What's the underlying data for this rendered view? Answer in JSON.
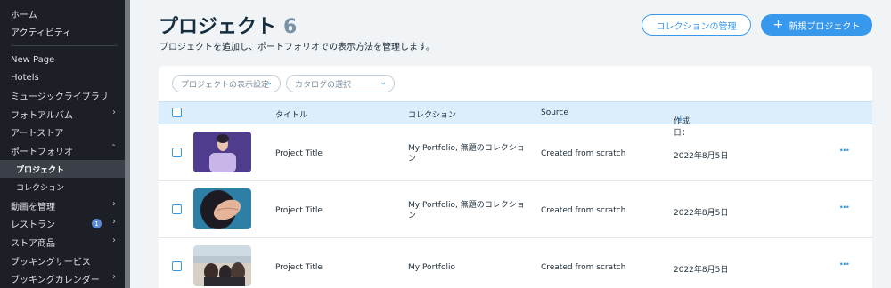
{
  "sidebar": {
    "items": [
      {
        "label": "ホーム"
      },
      {
        "label": "アクティビティ"
      },
      {
        "label": "New Page"
      },
      {
        "label": "Hotels"
      },
      {
        "label": "ミュージックライブラリ"
      },
      {
        "label": "フォトアルバム"
      },
      {
        "label": "アートストア"
      },
      {
        "label": "ポートフォリオ"
      },
      {
        "label": "プロジェクト"
      },
      {
        "label": "コレクション"
      },
      {
        "label": "動画を管理"
      },
      {
        "label": "レストラン",
        "badge": "1"
      },
      {
        "label": "ストア商品"
      },
      {
        "label": "ブッキングサービス"
      },
      {
        "label": "ブッキングカレンダー"
      }
    ]
  },
  "header": {
    "title": "プロジェクト",
    "count": "6",
    "subtitle": "プロジェクトを追加し、ポートフォリオでの表示方法を管理します。",
    "manage_collections_label": "コレクションの管理",
    "new_project_label": "新規プロジェクト"
  },
  "filters": {
    "display_settings": "プロジェクトの表示設定",
    "catalog_select": "カタログの選択"
  },
  "table": {
    "columns": [
      "タイトル",
      "コレクション",
      "Source",
      "作成日："
    ],
    "rows": [
      {
        "title": "Project Title",
        "collection": "My Portfolio, 無題のコレクショ ン",
        "source": "Created from scratch",
        "date": "2022年8月5日"
      },
      {
        "title": "Project Title",
        "collection": "My Portfolio, 無題のコレクショ ン",
        "source": "Created from scratch",
        "date": "2022年8月5日"
      },
      {
        "title": "Project Title",
        "collection": "My Portfolio",
        "source": "Created from scratch",
        "date": "2022年8月5日"
      }
    ],
    "more_glyph": "···"
  },
  "colors": {
    "accent": "#3899ec",
    "sidebar_bg": "#1c1f26",
    "table_header_bg": "#dceefc"
  }
}
